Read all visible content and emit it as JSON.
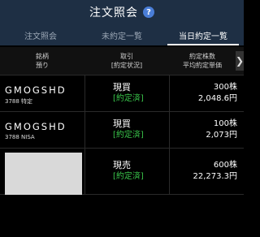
{
  "header": {
    "title": "注文照会",
    "help_icon": "?"
  },
  "tabs": [
    {
      "label": "注文照会",
      "active": false
    },
    {
      "label": "未約定一覧",
      "active": false
    },
    {
      "label": "当日約定一覧",
      "active": true
    }
  ],
  "columns": {
    "c1_line1": "銘柄",
    "c1_line2": "預り",
    "c2_line1": "取引",
    "c2_line2": "[約定状況]",
    "c3_line1": "約定株数",
    "c3_line2": "平均約定単価",
    "arrow": "❯"
  },
  "rows": [
    {
      "name": "GMOGSHD",
      "sub": "3788 特定",
      "side": "現買",
      "status": "[約定済]",
      "qty": "300株",
      "price": "2,048.6円"
    },
    {
      "name": "GMOGSHD",
      "sub": "3788 NISA",
      "side": "現買",
      "status": "[約定済]",
      "qty": "100株",
      "price": "2,073円"
    },
    {
      "name": "",
      "sub": "",
      "side": "現売",
      "status": "[約定済]",
      "qty": "600株",
      "price": "22,273.3円"
    }
  ],
  "colors": {
    "header_bg": "#1e2f44",
    "status_green": "#39c34a",
    "help_blue": "#4a7ed8"
  }
}
